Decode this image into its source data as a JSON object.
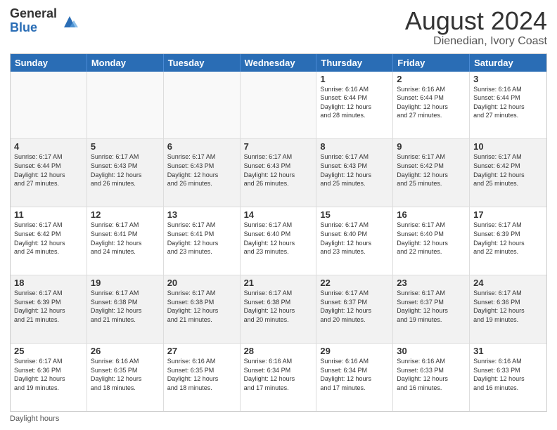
{
  "header": {
    "logo_general": "General",
    "logo_blue": "Blue",
    "main_title": "August 2024",
    "subtitle": "Dienedian, Ivory Coast"
  },
  "day_headers": [
    "Sunday",
    "Monday",
    "Tuesday",
    "Wednesday",
    "Thursday",
    "Friday",
    "Saturday"
  ],
  "weeks": [
    [
      {
        "day": "",
        "info": "",
        "empty": true
      },
      {
        "day": "",
        "info": "",
        "empty": true
      },
      {
        "day": "",
        "info": "",
        "empty": true
      },
      {
        "day": "",
        "info": "",
        "empty": true
      },
      {
        "day": "1",
        "info": "Sunrise: 6:16 AM\nSunset: 6:44 PM\nDaylight: 12 hours\nand 28 minutes.",
        "empty": false
      },
      {
        "day": "2",
        "info": "Sunrise: 6:16 AM\nSunset: 6:44 PM\nDaylight: 12 hours\nand 27 minutes.",
        "empty": false
      },
      {
        "day": "3",
        "info": "Sunrise: 6:16 AM\nSunset: 6:44 PM\nDaylight: 12 hours\nand 27 minutes.",
        "empty": false
      }
    ],
    [
      {
        "day": "4",
        "info": "Sunrise: 6:17 AM\nSunset: 6:44 PM\nDaylight: 12 hours\nand 27 minutes.",
        "empty": false
      },
      {
        "day": "5",
        "info": "Sunrise: 6:17 AM\nSunset: 6:43 PM\nDaylight: 12 hours\nand 26 minutes.",
        "empty": false
      },
      {
        "day": "6",
        "info": "Sunrise: 6:17 AM\nSunset: 6:43 PM\nDaylight: 12 hours\nand 26 minutes.",
        "empty": false
      },
      {
        "day": "7",
        "info": "Sunrise: 6:17 AM\nSunset: 6:43 PM\nDaylight: 12 hours\nand 26 minutes.",
        "empty": false
      },
      {
        "day": "8",
        "info": "Sunrise: 6:17 AM\nSunset: 6:43 PM\nDaylight: 12 hours\nand 25 minutes.",
        "empty": false
      },
      {
        "day": "9",
        "info": "Sunrise: 6:17 AM\nSunset: 6:42 PM\nDaylight: 12 hours\nand 25 minutes.",
        "empty": false
      },
      {
        "day": "10",
        "info": "Sunrise: 6:17 AM\nSunset: 6:42 PM\nDaylight: 12 hours\nand 25 minutes.",
        "empty": false
      }
    ],
    [
      {
        "day": "11",
        "info": "Sunrise: 6:17 AM\nSunset: 6:42 PM\nDaylight: 12 hours\nand 24 minutes.",
        "empty": false
      },
      {
        "day": "12",
        "info": "Sunrise: 6:17 AM\nSunset: 6:41 PM\nDaylight: 12 hours\nand 24 minutes.",
        "empty": false
      },
      {
        "day": "13",
        "info": "Sunrise: 6:17 AM\nSunset: 6:41 PM\nDaylight: 12 hours\nand 23 minutes.",
        "empty": false
      },
      {
        "day": "14",
        "info": "Sunrise: 6:17 AM\nSunset: 6:40 PM\nDaylight: 12 hours\nand 23 minutes.",
        "empty": false
      },
      {
        "day": "15",
        "info": "Sunrise: 6:17 AM\nSunset: 6:40 PM\nDaylight: 12 hours\nand 23 minutes.",
        "empty": false
      },
      {
        "day": "16",
        "info": "Sunrise: 6:17 AM\nSunset: 6:40 PM\nDaylight: 12 hours\nand 22 minutes.",
        "empty": false
      },
      {
        "day": "17",
        "info": "Sunrise: 6:17 AM\nSunset: 6:39 PM\nDaylight: 12 hours\nand 22 minutes.",
        "empty": false
      }
    ],
    [
      {
        "day": "18",
        "info": "Sunrise: 6:17 AM\nSunset: 6:39 PM\nDaylight: 12 hours\nand 21 minutes.",
        "empty": false
      },
      {
        "day": "19",
        "info": "Sunrise: 6:17 AM\nSunset: 6:38 PM\nDaylight: 12 hours\nand 21 minutes.",
        "empty": false
      },
      {
        "day": "20",
        "info": "Sunrise: 6:17 AM\nSunset: 6:38 PM\nDaylight: 12 hours\nand 21 minutes.",
        "empty": false
      },
      {
        "day": "21",
        "info": "Sunrise: 6:17 AM\nSunset: 6:38 PM\nDaylight: 12 hours\nand 20 minutes.",
        "empty": false
      },
      {
        "day": "22",
        "info": "Sunrise: 6:17 AM\nSunset: 6:37 PM\nDaylight: 12 hours\nand 20 minutes.",
        "empty": false
      },
      {
        "day": "23",
        "info": "Sunrise: 6:17 AM\nSunset: 6:37 PM\nDaylight: 12 hours\nand 19 minutes.",
        "empty": false
      },
      {
        "day": "24",
        "info": "Sunrise: 6:17 AM\nSunset: 6:36 PM\nDaylight: 12 hours\nand 19 minutes.",
        "empty": false
      }
    ],
    [
      {
        "day": "25",
        "info": "Sunrise: 6:17 AM\nSunset: 6:36 PM\nDaylight: 12 hours\nand 19 minutes.",
        "empty": false
      },
      {
        "day": "26",
        "info": "Sunrise: 6:16 AM\nSunset: 6:35 PM\nDaylight: 12 hours\nand 18 minutes.",
        "empty": false
      },
      {
        "day": "27",
        "info": "Sunrise: 6:16 AM\nSunset: 6:35 PM\nDaylight: 12 hours\nand 18 minutes.",
        "empty": false
      },
      {
        "day": "28",
        "info": "Sunrise: 6:16 AM\nSunset: 6:34 PM\nDaylight: 12 hours\nand 17 minutes.",
        "empty": false
      },
      {
        "day": "29",
        "info": "Sunrise: 6:16 AM\nSunset: 6:34 PM\nDaylight: 12 hours\nand 17 minutes.",
        "empty": false
      },
      {
        "day": "30",
        "info": "Sunrise: 6:16 AM\nSunset: 6:33 PM\nDaylight: 12 hours\nand 16 minutes.",
        "empty": false
      },
      {
        "day": "31",
        "info": "Sunrise: 6:16 AM\nSunset: 6:33 PM\nDaylight: 12 hours\nand 16 minutes.",
        "empty": false
      }
    ]
  ],
  "footer": {
    "daylight_label": "Daylight hours"
  }
}
